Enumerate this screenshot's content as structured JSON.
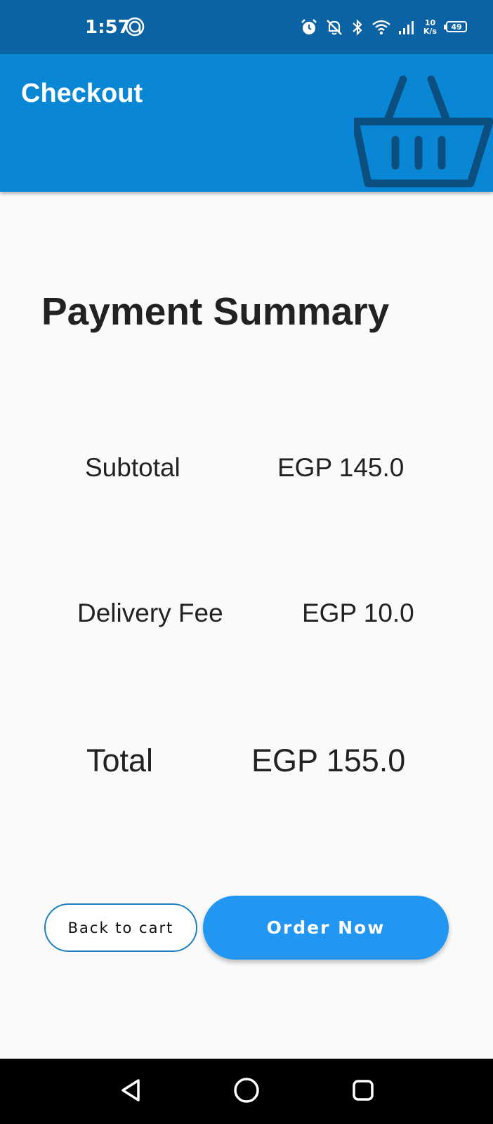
{
  "status_bar": {
    "time": "1:57",
    "net_speed_value": "10",
    "net_speed_unit": "K/s",
    "battery": "49",
    "background_color": "#0b63a3"
  },
  "app_bar": {
    "title": "Checkout",
    "icon": "shopping-basket-icon",
    "background_color": "#0987d4",
    "icon_color": "#0b4f80"
  },
  "summary": {
    "title": "Payment Summary",
    "rows": [
      {
        "label": "Subtotal",
        "value": "EGP 145.0"
      },
      {
        "label": "Delivery Fee",
        "value": "EGP 10.0"
      },
      {
        "label": "Total",
        "value": "EGP 155.0"
      }
    ]
  },
  "actions": {
    "back_label": "Back to cart",
    "order_label": "Order Now",
    "primary_color": "#2196f3",
    "outline_color": "#1e7fbf"
  },
  "nav": {
    "back_icon": "triangle-back-icon",
    "home_icon": "circle-home-icon",
    "recents_icon": "square-recents-icon"
  }
}
